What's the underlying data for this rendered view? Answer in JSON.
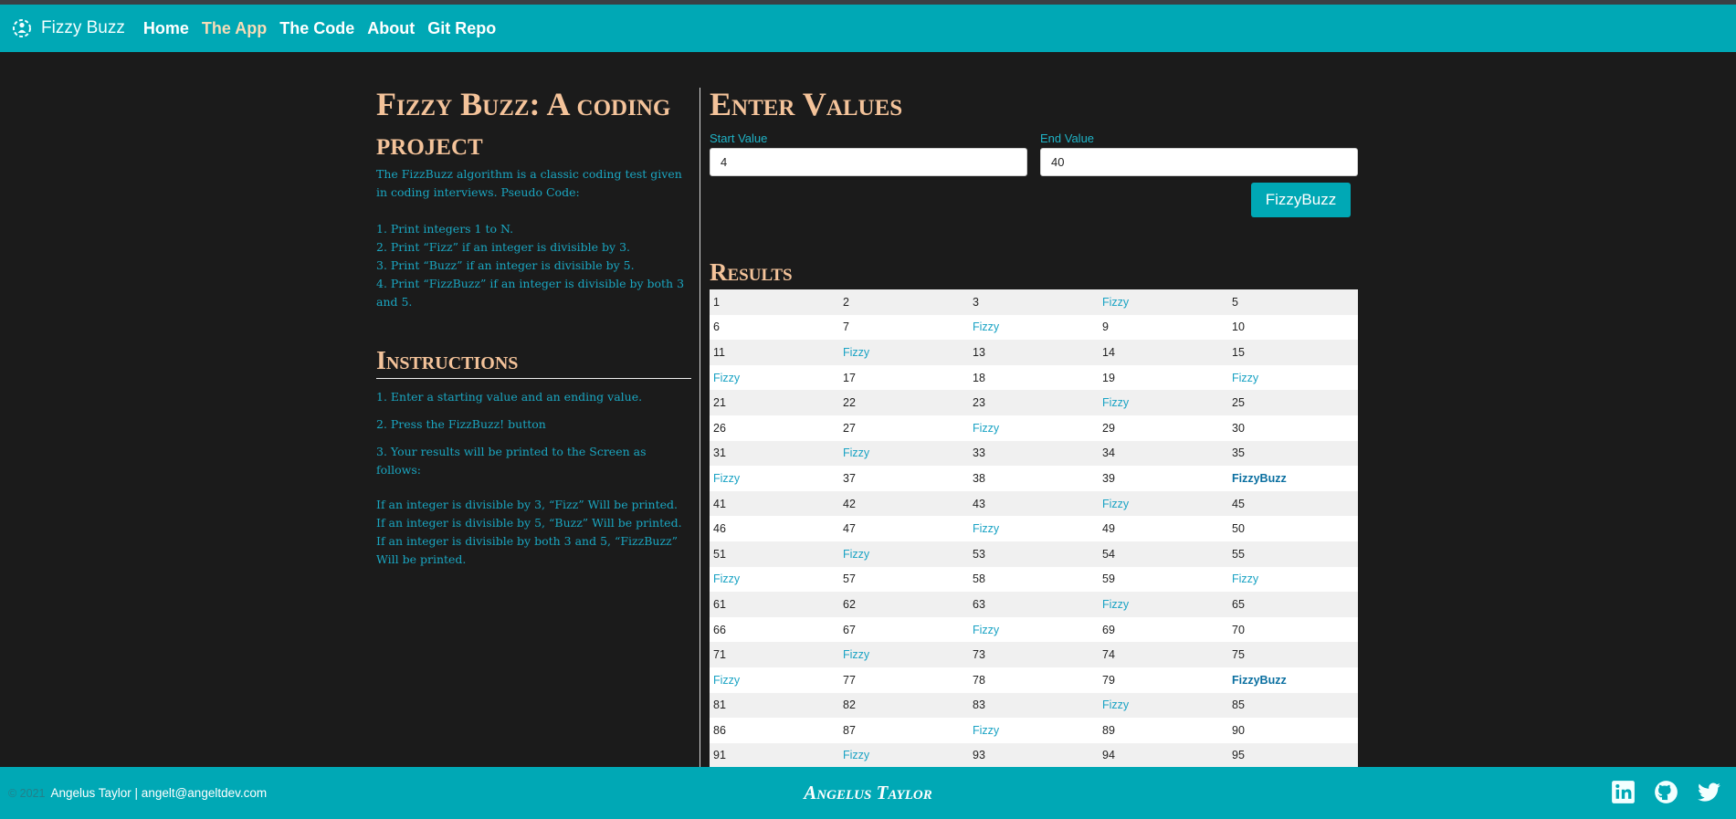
{
  "nav": {
    "brand": "Fizzy Buzz",
    "links": [
      "Home",
      "The App",
      "The Code",
      "About",
      "Git Repo"
    ],
    "active": "The App"
  },
  "left": {
    "title": "Fizzy Buzz: A coding project",
    "description": "The FizzBuzz algorithm is a classic coding test given in coding interviews. Pseudo Code:",
    "steps": [
      "1. Print integers 1 to N.",
      "2. Print “Fizz” if an integer is divisible by 3.",
      "3. Print “Buzz” if an integer is divisible by 5.",
      "4. Print “FizzBuzz” if an integer is divisible by both 3 and 5."
    ],
    "instructions_title": "Instructions",
    "instructions": [
      "1. Enter a starting value and an ending value.",
      "2. Press the FizzBuzz! button",
      "3. Your results will be printed to the Screen as follows:"
    ],
    "rules": [
      "If an integer is divisible by 3, “Fizz” Will be printed.",
      "If an integer is divisible by 5, “Buzz” Will be printed.",
      "If an integer is divisible by both 3 and 5, “FizzBuzz” Will be printed."
    ]
  },
  "form": {
    "title": "Enter Values",
    "start_label": "Start Value",
    "start_value": "4",
    "end_label": "End Value",
    "end_value": "40",
    "button": "FizzyBuzz"
  },
  "results": {
    "title": "Results",
    "rows": [
      [
        "1",
        "2",
        "3",
        "Fizzy",
        "5"
      ],
      [
        "6",
        "7",
        "Fizzy",
        "9",
        "10"
      ],
      [
        "11",
        "Fizzy",
        "13",
        "14",
        "15"
      ],
      [
        "Fizzy",
        "17",
        "18",
        "19",
        "Fizzy"
      ],
      [
        "21",
        "22",
        "23",
        "Fizzy",
        "25"
      ],
      [
        "26",
        "27",
        "Fizzy",
        "29",
        "30"
      ],
      [
        "31",
        "Fizzy",
        "33",
        "34",
        "35"
      ],
      [
        "Fizzy",
        "37",
        "38",
        "39",
        "FizzyBuzz"
      ],
      [
        "41",
        "42",
        "43",
        "Fizzy",
        "45"
      ],
      [
        "46",
        "47",
        "Fizzy",
        "49",
        "50"
      ],
      [
        "51",
        "Fizzy",
        "53",
        "54",
        "55"
      ],
      [
        "Fizzy",
        "57",
        "58",
        "59",
        "Fizzy"
      ],
      [
        "61",
        "62",
        "63",
        "Fizzy",
        "65"
      ],
      [
        "66",
        "67",
        "Fizzy",
        "69",
        "70"
      ],
      [
        "71",
        "Fizzy",
        "73",
        "74",
        "75"
      ],
      [
        "Fizzy",
        "77",
        "78",
        "79",
        "FizzyBuzz"
      ],
      [
        "81",
        "82",
        "83",
        "Fizzy",
        "85"
      ],
      [
        "86",
        "87",
        "Fizzy",
        "89",
        "90"
      ],
      [
        "91",
        "Fizzy",
        "93",
        "94",
        "95"
      ]
    ]
  },
  "footer": {
    "copyright": "© 2021",
    "owner": "Angelus Taylor | angelt@angeltdev.com",
    "brand": "Angelus Taylor",
    "socials": [
      "linkedin-icon",
      "github-icon",
      "twitter-icon"
    ]
  },
  "colors": {
    "accent": "#00a8b5",
    "background": "#1b1b1b",
    "heading": "#f4c39a",
    "text": "#1aa6c1"
  }
}
